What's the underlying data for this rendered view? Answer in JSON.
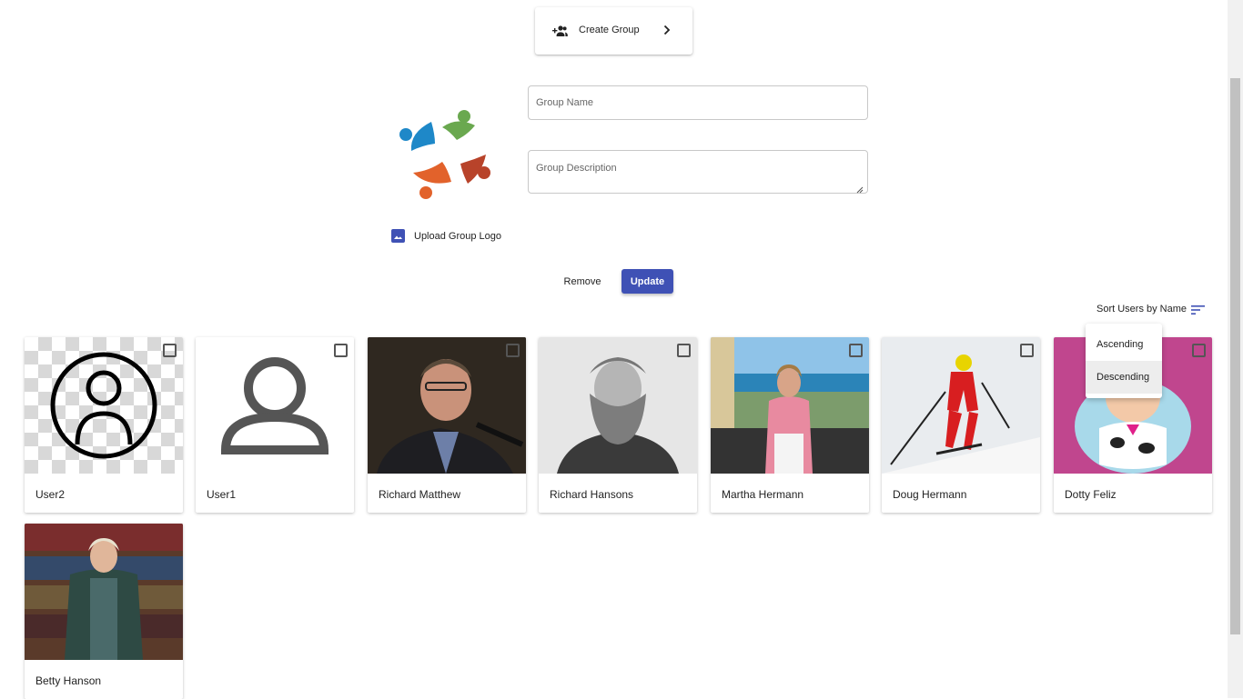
{
  "toolbar": {
    "create_group_label": "Create Group"
  },
  "form": {
    "group_name_placeholder": "Group Name",
    "group_description_placeholder": "Group Description",
    "upload_logo_label": "Upload Group Logo",
    "remove_label": "Remove",
    "update_label": "Update"
  },
  "sort": {
    "label": "Sort Users by Name",
    "options": [
      "Ascending",
      "Descending"
    ],
    "highlighted": "Descending"
  },
  "users": [
    {
      "name": "User2",
      "checked": false
    },
    {
      "name": "User1",
      "checked": false
    },
    {
      "name": "Richard Matthew",
      "checked": false
    },
    {
      "name": "Richard Hansons",
      "checked": false
    },
    {
      "name": "Martha Hermann",
      "checked": false
    },
    {
      "name": "Doug Hermann",
      "checked": false
    },
    {
      "name": "Dotty Feliz",
      "checked": false
    },
    {
      "name": "Betty Hanson",
      "checked": false
    }
  ],
  "colors": {
    "accent": "#3f51b5",
    "logo_blue": "#1e88c8",
    "logo_green": "#6aa84f",
    "logo_orange": "#e2622b",
    "logo_red": "#b8432a"
  }
}
